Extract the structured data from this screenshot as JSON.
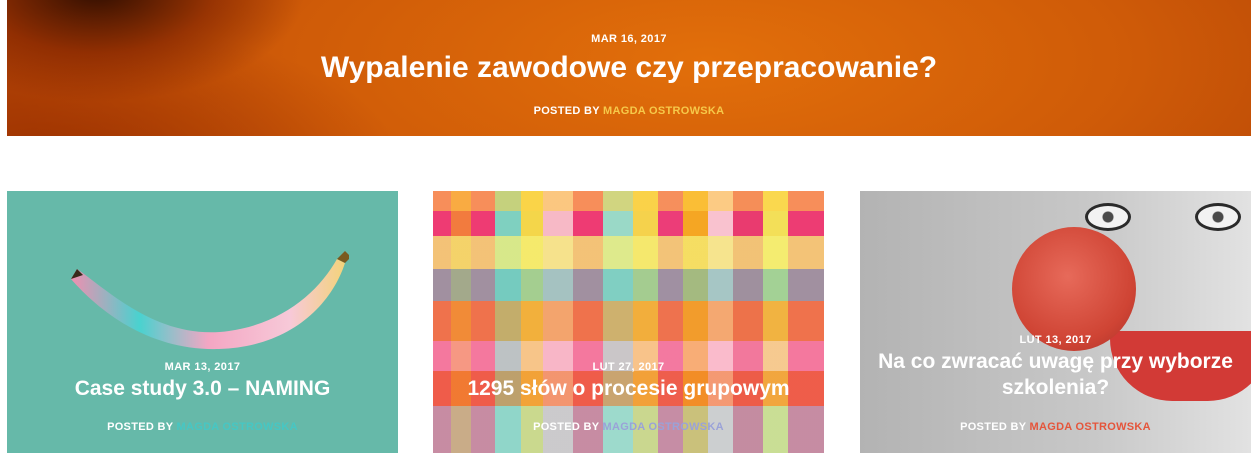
{
  "hero": {
    "date": "MAR 16, 2017",
    "title": "Wypalenie zawodowe czy przepracowanie?",
    "posted_by": "POSTED BY",
    "author": "MAGDA OSTROWSKA"
  },
  "cards": [
    {
      "date": "MAR 13, 2017",
      "title": "Case study 3.0 – NAMING",
      "posted_by": "POSTED BY",
      "author": "MAGDA OSTROWSKA",
      "accent": "#46c7c4"
    },
    {
      "date": "LUT 27, 2017",
      "title": "1295 słów o procesie grupowym",
      "posted_by": "POSTED BY",
      "author": "MAGDA OSTROWSKA",
      "accent": "#9aa2d8"
    },
    {
      "date": "LUT 13, 2017",
      "title": "Na co zwracać uwagę przy wyborze szkolenia?",
      "posted_by": "POSTED BY",
      "author": "MAGDA OSTROWSKA",
      "accent": "#e5553b"
    }
  ],
  "colors": {
    "hero_background": "#d9640a",
    "hero_author": "#f6c94a",
    "card1_background": "#66b9a9"
  }
}
